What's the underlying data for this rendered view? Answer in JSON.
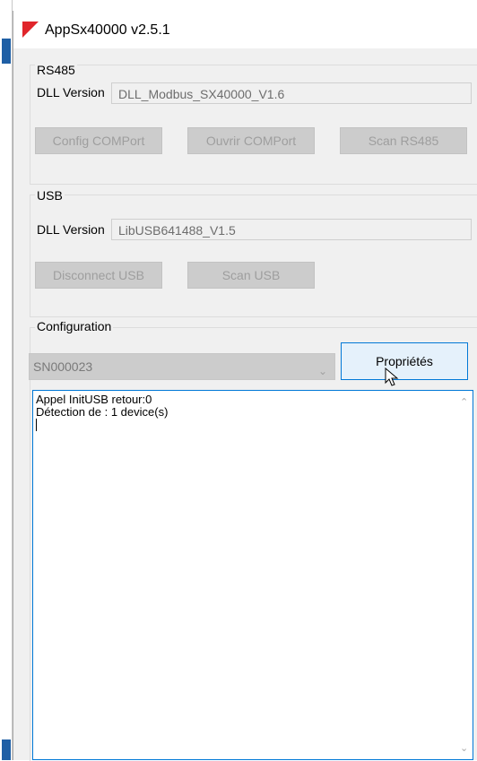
{
  "window": {
    "title": "AppSx40000 v2.5.1"
  },
  "rs485": {
    "group_label": "RS485",
    "dll_label": "DLL Version",
    "dll_value": "DLL_Modbus_SX40000_V1.6",
    "buttons": [
      "Config COMPort",
      "Ouvrir COMPort",
      "Scan RS485"
    ]
  },
  "usb": {
    "group_label": "USB",
    "dll_label": "DLL Version",
    "dll_value": "LibUSB641488_V1.5",
    "buttons": [
      "Disconnect USB",
      "Scan USB"
    ]
  },
  "configuration": {
    "group_label": "Configuration",
    "device_select": "SN000023",
    "properties_button": "Propriétés"
  },
  "log": {
    "lines": [
      "Appel InitUSB retour:0",
      "Détection de : 1 device(s)"
    ]
  }
}
